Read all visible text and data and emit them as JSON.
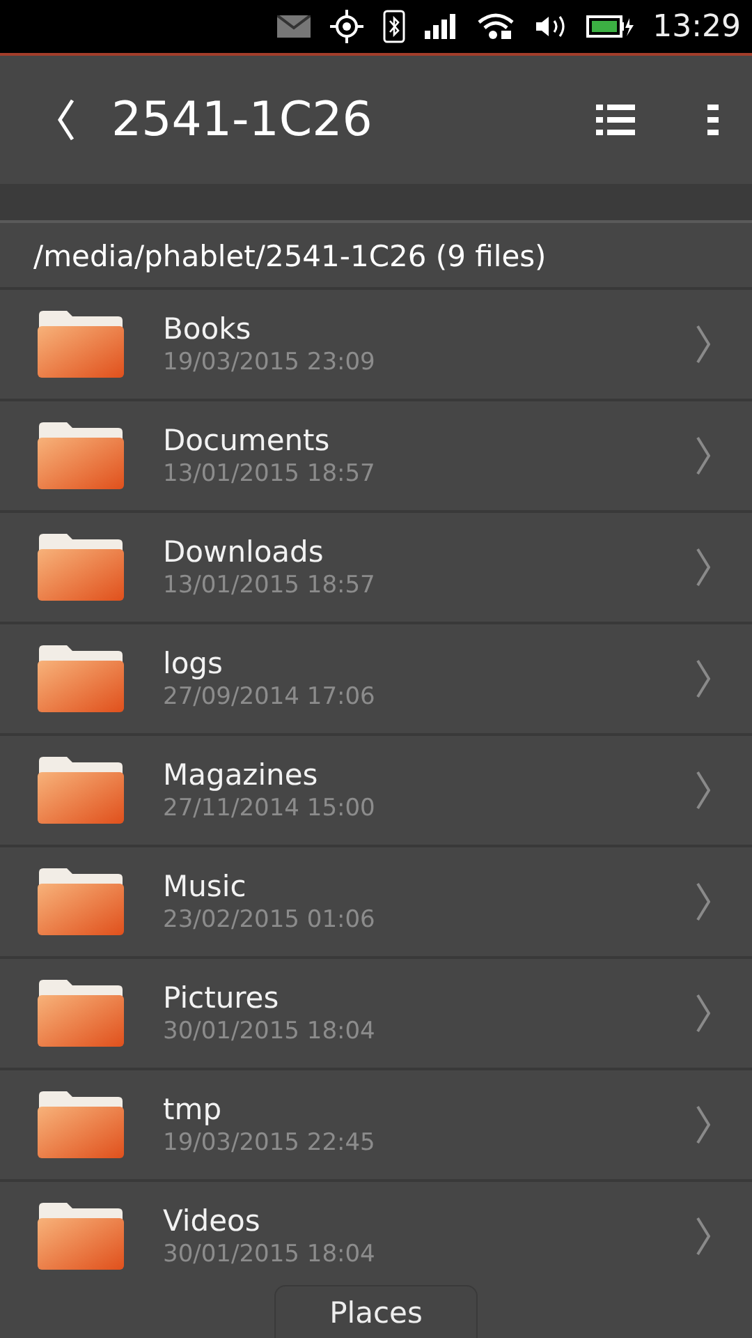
{
  "status_bar": {
    "time": "13:29"
  },
  "header": {
    "title": "2541-1C26"
  },
  "path": "/media/phablet/2541-1C26 (9 files)",
  "folders": [
    {
      "name": "Books",
      "modified": "19/03/2015 23:09"
    },
    {
      "name": "Documents",
      "modified": "13/01/2015 18:57"
    },
    {
      "name": "Downloads",
      "modified": "13/01/2015 18:57"
    },
    {
      "name": "logs",
      "modified": "27/09/2014 17:06"
    },
    {
      "name": "Magazines",
      "modified": "27/11/2014 15:00"
    },
    {
      "name": "Music",
      "modified": "23/02/2015 01:06"
    },
    {
      "name": "Pictures",
      "modified": "30/01/2015 18:04"
    },
    {
      "name": "tmp",
      "modified": "19/03/2015 22:45"
    },
    {
      "name": "Videos",
      "modified": "30/01/2015 18:04"
    }
  ],
  "bottom_tab": {
    "label": "Places"
  }
}
